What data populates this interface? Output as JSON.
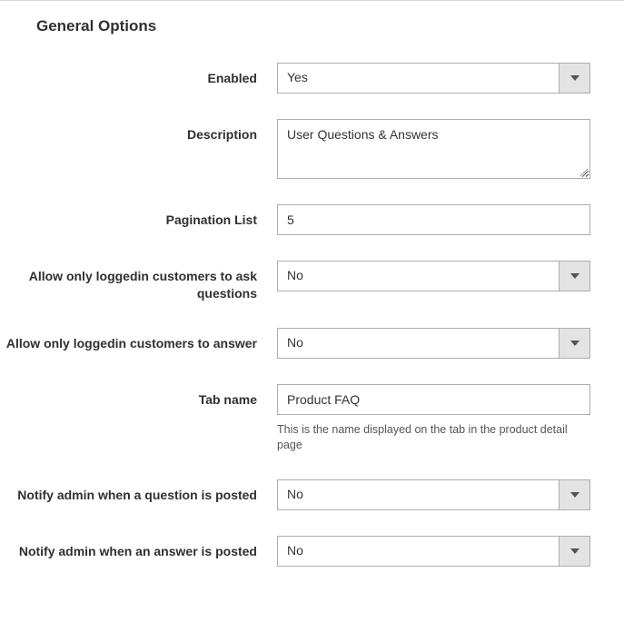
{
  "section": {
    "title": "General Options"
  },
  "fields": {
    "enabled": {
      "label": "Enabled",
      "value": "Yes"
    },
    "description": {
      "label": "Description",
      "value": "User Questions & Answers"
    },
    "pagination_list": {
      "label": "Pagination List",
      "value": "5"
    },
    "allow_loggedin_ask": {
      "label": "Allow only loggedin customers to ask questions",
      "value": "No"
    },
    "allow_loggedin_answer": {
      "label": "Allow only loggedin customers to answer",
      "value": "No"
    },
    "tab_name": {
      "label": "Tab name",
      "value": "Product FAQ",
      "help": "This is the name displayed on the tab in the product detail page"
    },
    "notify_admin_question": {
      "label": "Notify admin when a question is posted",
      "value": "No"
    },
    "notify_admin_answer": {
      "label": "Notify admin when an answer is posted",
      "value": "No"
    }
  }
}
